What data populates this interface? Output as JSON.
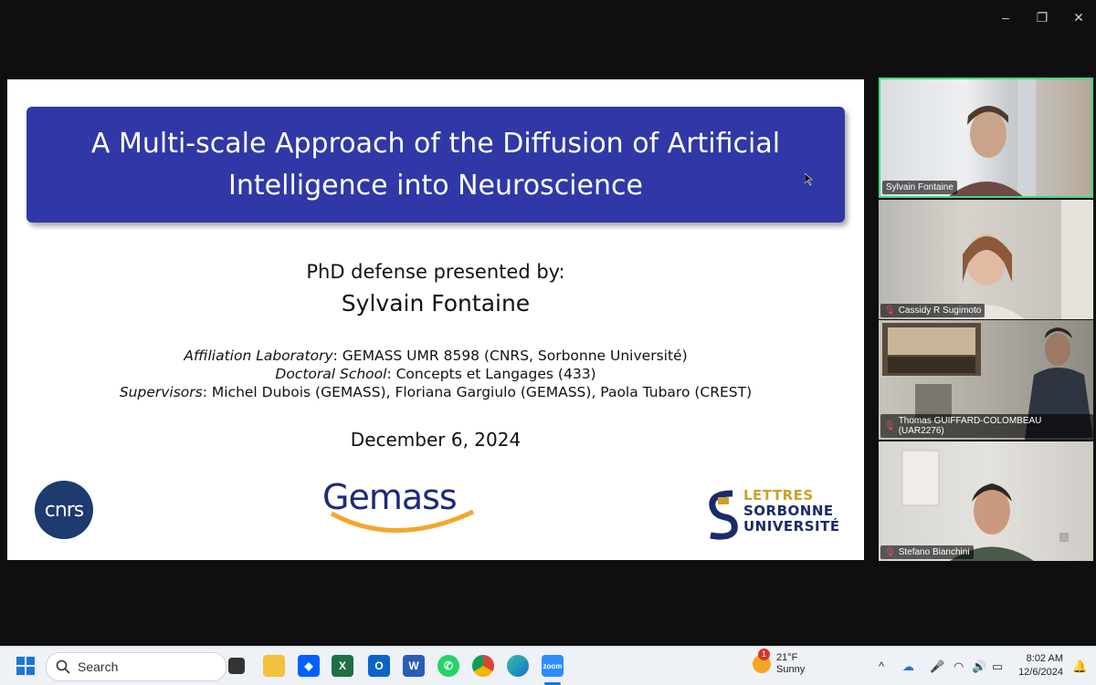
{
  "window": {
    "minimize": "–",
    "restore": "❐",
    "close": "✕"
  },
  "slide": {
    "title": "A Multi-scale Approach of the Diffusion of Artificial Intelligence into Neuroscience",
    "presented_by": "PhD defense presented by:",
    "presenter": "Sylvain Fontaine",
    "affiliation_label": "Affiliation Laboratory",
    "affiliation_value": ": GEMASS UMR 8598 (CNRS, Sorbonne Université)",
    "school_label": "Doctoral School",
    "school_value": ": Concepts et Langages (433)",
    "supervisors_label": "Supervisors",
    "supervisors_value": ": Michel Dubois (GEMASS), Floriana Gargiulo (GEMASS), Paola Tubaro (CREST)",
    "date": "December 6, 2024",
    "logos": {
      "cnrs": "cnrs",
      "gemass": "Gemass",
      "sorbonne_line1": "LETTRES",
      "sorbonne_line2": "SORBONNE",
      "sorbonne_line3": "UNIVERSITÉ"
    }
  },
  "participants": [
    {
      "name": "Sylvain Fontaine",
      "muted": false,
      "active": true
    },
    {
      "name": "Cassidy R Sugimoto",
      "muted": true,
      "active": false
    },
    {
      "name": "Thomas GUIFFARD-COLOMBEAU (UAR2276)",
      "muted": true,
      "active": false
    },
    {
      "name": "Stefano Bianchini",
      "muted": true,
      "active": false
    }
  ],
  "taskbar": {
    "search_placeholder": "Search",
    "weather_badge": "1",
    "weather_temp": "21°F",
    "weather_desc": "Sunny",
    "time": "8:02 AM",
    "date": "12/6/2024",
    "apps": [
      "start",
      "search",
      "task-view",
      "file-explorer",
      "dropbox",
      "excel",
      "outlook",
      "word",
      "whatsapp",
      "chrome",
      "edge",
      "zoom"
    ]
  },
  "colors": {
    "title_bg": "#2f38a6",
    "active_border": "#3ddc84",
    "mute": "#e04b4b"
  }
}
